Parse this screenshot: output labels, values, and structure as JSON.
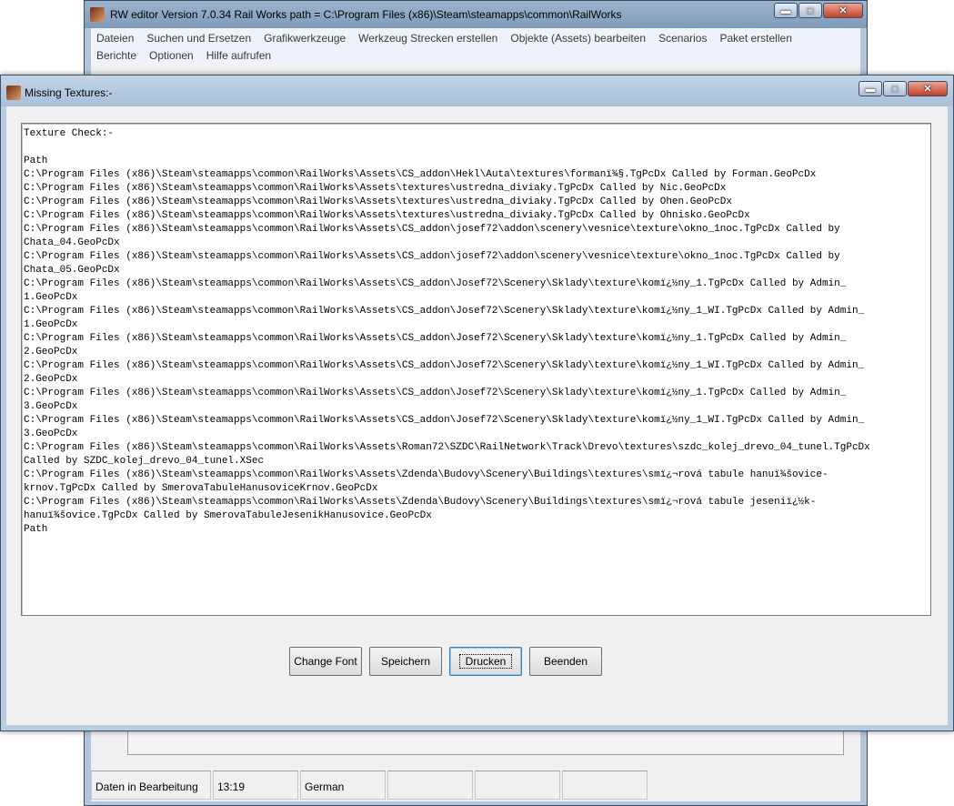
{
  "main_window": {
    "title": "RW editor  Version 7.0.34   Rail Works path = C:\\Program Files (x86)\\Steam\\steamapps\\common\\RailWorks",
    "menu": [
      "Dateien",
      "Suchen und Ersetzen",
      "Grafikwerkzeuge",
      "Werkzeug Strecken erstellen",
      "Objekte (Assets) bearbeiten",
      "Scenarios",
      "Paket erstellen",
      "Berichte",
      "Optionen",
      "Hilfe aufrufen"
    ],
    "status_bar": [
      "Daten in Bearbeitung",
      "13:19",
      "German",
      "",
      "",
      ""
    ]
  },
  "dialog": {
    "title": "Missing Textures:-",
    "lines": [
      "Texture Check:-",
      "",
      "Path",
      "C:\\Program Files (x86)\\Steam\\steamapps\\common\\RailWorks\\Assets\\CS_addon\\Hekl\\Auta\\textures\\formanï¾§.TgPcDx Called by Forman.GeoPcDx",
      "C:\\Program Files (x86)\\Steam\\steamapps\\common\\RailWorks\\Assets\\textures\\ustredna_diviaky.TgPcDx Called by Nic.GeoPcDx",
      "C:\\Program Files (x86)\\Steam\\steamapps\\common\\RailWorks\\Assets\\textures\\ustredna_diviaky.TgPcDx Called by Ohen.GeoPcDx",
      "C:\\Program Files (x86)\\Steam\\steamapps\\common\\RailWorks\\Assets\\textures\\ustredna_diviaky.TgPcDx Called by Ohnisko.GeoPcDx",
      "C:\\Program Files (x86)\\Steam\\steamapps\\common\\RailWorks\\Assets\\CS_addon\\josef72\\addon\\scenery\\vesnice\\texture\\okno_1noc.TgPcDx Called by",
      "Chata_04.GeoPcDx",
      "C:\\Program Files (x86)\\Steam\\steamapps\\common\\RailWorks\\Assets\\CS_addon\\josef72\\addon\\scenery\\vesnice\\texture\\okno_1noc.TgPcDx Called by",
      "Chata_05.GeoPcDx",
      "C:\\Program Files (x86)\\Steam\\steamapps\\common\\RailWorks\\Assets\\CS_addon\\Josef72\\Scenery\\Sklady\\texture\\komï¿½ny_1.TgPcDx Called by Admin_",
      "1.GeoPcDx",
      "C:\\Program Files (x86)\\Steam\\steamapps\\common\\RailWorks\\Assets\\CS_addon\\Josef72\\Scenery\\Sklady\\texture\\komï¿½ny_1_WI.TgPcDx Called by Admin_",
      "1.GeoPcDx",
      "C:\\Program Files (x86)\\Steam\\steamapps\\common\\RailWorks\\Assets\\CS_addon\\Josef72\\Scenery\\Sklady\\texture\\komï¿½ny_1.TgPcDx Called by Admin_",
      "2.GeoPcDx",
      "C:\\Program Files (x86)\\Steam\\steamapps\\common\\RailWorks\\Assets\\CS_addon\\Josef72\\Scenery\\Sklady\\texture\\komï¿½ny_1_WI.TgPcDx Called by Admin_",
      "2.GeoPcDx",
      "C:\\Program Files (x86)\\Steam\\steamapps\\common\\RailWorks\\Assets\\CS_addon\\Josef72\\Scenery\\Sklady\\texture\\komï¿½ny_1.TgPcDx Called by Admin_",
      "3.GeoPcDx",
      "C:\\Program Files (x86)\\Steam\\steamapps\\common\\RailWorks\\Assets\\CS_addon\\Josef72\\Scenery\\Sklady\\texture\\komï¿½ny_1_WI.TgPcDx Called by Admin_",
      "3.GeoPcDx",
      "C:\\Program Files (x86)\\Steam\\steamapps\\common\\RailWorks\\Assets\\Roman72\\SZDC\\RailNetwork\\Track\\Drevo\\textures\\szdc_kolej_drevo_04_tunel.TgPcDx",
      "Called by SZDC_kolej_drevo_04_tunel.XSec",
      "C:\\Program Files (x86)\\Steam\\steamapps\\common\\RailWorks\\Assets\\Zdenda\\Budovy\\Scenery\\Buildings\\textures\\smï¿¬rová tabule hanuï¾šovice-",
      "krnov.TgPcDx Called by SmerovaTabuleHanusoviceKrnov.GeoPcDx",
      "C:\\Program Files (x86)\\Steam\\steamapps\\common\\RailWorks\\Assets\\Zdenda\\Budovy\\Scenery\\Buildings\\textures\\smï¿¬rová tabule jeseniï¿½k-",
      "hanuï¾šovice.TgPcDx Called by SmerovaTabuleJesenikHanusovice.GeoPcDx",
      "Path"
    ],
    "buttons": {
      "change_font": "Change Font",
      "speichern": "Speichern",
      "drucken": "Drucken",
      "beenden": "Beenden"
    }
  },
  "window_controls": {
    "minimize": "▬",
    "maximize": "□",
    "close": "✕"
  },
  "colors": {
    "titlebar": "#a9c0d9",
    "close_button": "#c4402a"
  }
}
